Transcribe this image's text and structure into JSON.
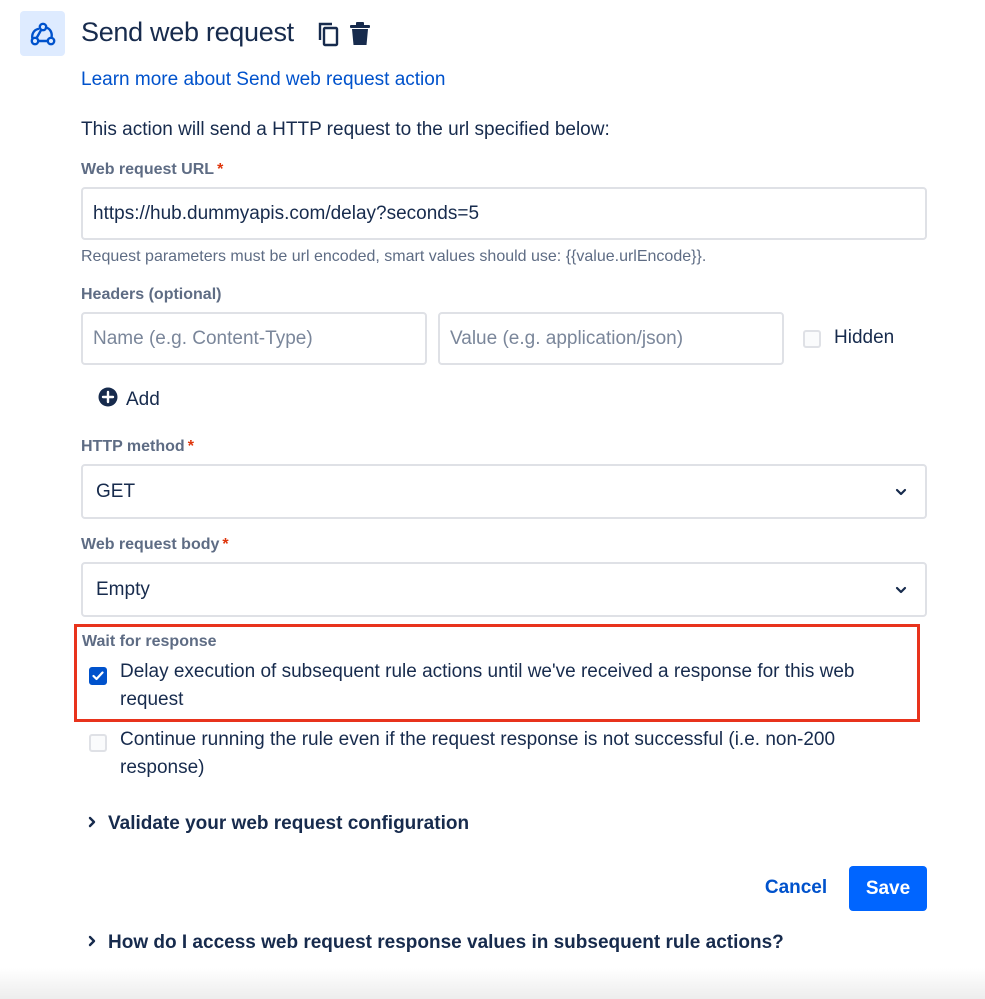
{
  "header": {
    "title": "Send web request",
    "icons": [
      "webhook-icon",
      "copy-icon",
      "trash-icon"
    ]
  },
  "learn_more_link": "Learn more about Send web request action",
  "description": "This action will send a HTTP request to the url specified below:",
  "url_field": {
    "label": "Web request URL",
    "required_marker": "*",
    "value": "https://hub.dummyapis.com/delay?seconds=5",
    "help": "Request parameters must be url encoded, smart values should use: {{value.urlEncode}}."
  },
  "headers": {
    "label": "Headers (optional)",
    "name_placeholder": "Name (e.g. Content-Type)",
    "value_placeholder": "Value (e.g. application/json)",
    "hidden_label": "Hidden",
    "hidden_checked": false,
    "add_label": "Add"
  },
  "http_method": {
    "label": "HTTP method",
    "required_marker": "*",
    "value": "GET"
  },
  "body": {
    "label": "Web request body",
    "required_marker": "*",
    "value": "Empty"
  },
  "wait_for_response": {
    "label": "Wait for response",
    "delay_option": {
      "text": "Delay execution of subsequent rule actions until we've received a response for this web request",
      "checked": true
    },
    "continue_option": {
      "text": "Continue running the rule even if the request response is not successful (i.e. non-200 response)",
      "checked": false
    }
  },
  "validate_section": "Validate your web request configuration",
  "actions": {
    "cancel": "Cancel",
    "save": "Save"
  },
  "faq_section": "How do I access web request response values in subsequent rule actions?",
  "colors": {
    "link": "#0052cc",
    "primary_button": "#0065ff",
    "highlight_border": "#e8331c",
    "required": "#de350b"
  }
}
